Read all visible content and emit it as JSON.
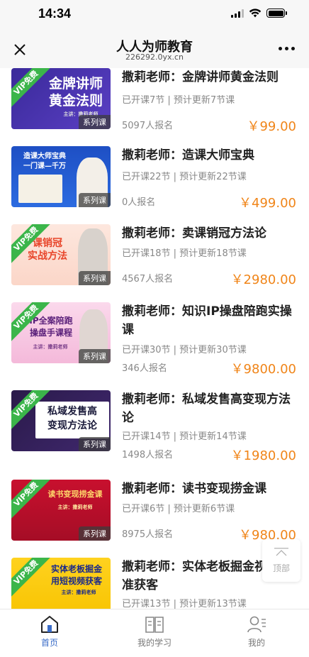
{
  "status": {
    "time": "14:34"
  },
  "nav": {
    "title": "人人为师教育",
    "subtitle": "226292.0yx.cn"
  },
  "ribbon": "VIP免费",
  "items": [
    {
      "title": "撒莉老师：金牌讲师黄金法则",
      "meta": "已开课7节 | 预计更新7节课",
      "count": "5097人报名",
      "price": "￥99.00",
      "tag": "系列课",
      "thumb_text": "金牌讲师\n黄金法则",
      "thumb_sub": "主讲：撒莉老师"
    },
    {
      "title": "撒莉老师：造课大师宝典",
      "meta": "已开课22节 | 预计更新22节课",
      "count": "0人报名",
      "price": "￥499.00",
      "tag": "系列课",
      "thumb_text": "造课大师宝典\n一门课—千万",
      "thumb_sub": ""
    },
    {
      "title": "撒莉老师：卖课销冠方法论",
      "meta": "已开课18节 | 预计更新18节课",
      "count": "4567人报名",
      "price": "￥2980.00",
      "tag": "系列课",
      "thumb_text": "课销冠\n实战方法",
      "thumb_sub": ""
    },
    {
      "title": "撒莉老师：知识IP操盘陪跑实操课",
      "meta": "已开课30节 | 预计更新30节课",
      "count": "346人报名",
      "price": "￥9800.00",
      "tag": "系列课",
      "thumb_text": "IP全案陪跑\n操盘手课程",
      "thumb_sub": "主讲：撒莉老师"
    },
    {
      "title": "撒莉老师：私域发售高变现方法论",
      "meta": "已开课14节 | 预计更新14节课",
      "count": "1498人报名",
      "price": "￥1980.00",
      "tag": "系列课",
      "thumb_text": "私域发售高\n变现方法论",
      "thumb_sub": ""
    },
    {
      "title": "撒莉老师：读书变现捞金课",
      "meta": "已开课6节 | 预计更新6节课",
      "count": "8975人报名",
      "price": "￥980.00",
      "tag": "系列课",
      "thumb_text": "读书变现捞金课",
      "thumb_sub": "主讲：撒莉老师"
    },
    {
      "title": "撒莉老师：实体老板掘金视频精准获客",
      "meta": "已开课13节 | 预计更新13节课",
      "count": "",
      "price": "",
      "tag": "",
      "thumb_text": "实体老板掘金\n用短视频获客",
      "thumb_sub": "主讲：撒莉老师"
    }
  ],
  "back_top": "顶部",
  "tabs": [
    {
      "label": "首页"
    },
    {
      "label": "我的学习"
    },
    {
      "label": "我的"
    }
  ],
  "colors": {
    "price": "#f08519",
    "ribbon": "#3bb54a",
    "tab_active": "#3a6cc8"
  },
  "icons": {
    "close": "close-icon",
    "more": "more-dots-icon",
    "home": "home-icon",
    "study": "book-icon",
    "mine": "user-icon"
  }
}
